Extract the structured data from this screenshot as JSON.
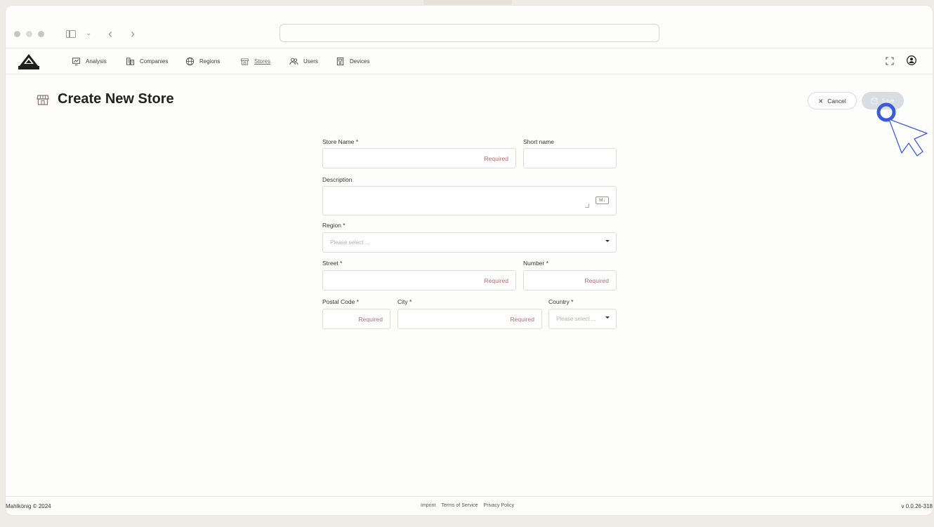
{
  "nav": {
    "items": [
      {
        "label": "Analysis",
        "icon": "chart-icon"
      },
      {
        "label": "Companies",
        "icon": "building-icon"
      },
      {
        "label": "Regions",
        "icon": "globe-icon"
      },
      {
        "label": "Stores",
        "icon": "store-icon",
        "active": true
      },
      {
        "label": "Users",
        "icon": "users-icon"
      },
      {
        "label": "Devices",
        "icon": "device-icon"
      }
    ]
  },
  "header": {
    "title": "Create New Store",
    "cancel_label": "Cancel",
    "save_label": "Save"
  },
  "form": {
    "store_name_label": "Store Name *",
    "store_name_placeholder": "Required",
    "short_name_label": "Short name",
    "description_label": "Description",
    "md_badge": "M↓",
    "region_label": "Region *",
    "region_placeholder": "Please select ...",
    "street_label": "Street *",
    "street_placeholder": "Required",
    "number_label": "Number *",
    "number_placeholder": "Required",
    "postal_label": "Postal Code *",
    "postal_placeholder": "Required",
    "city_label": "City *",
    "city_placeholder": "Required",
    "country_label": "Country *",
    "country_placeholder": "Please select ..."
  },
  "footer": {
    "copyright": "Mahlkönig © 2024",
    "imprint": "Imprint",
    "terms": "Terms of Service",
    "privacy": "Privacy Policy",
    "version": "v 0.0.26-318"
  },
  "colors": {
    "required_text": "#b06a72",
    "save_disabled_bg": "#d8dde4",
    "cursor_blue": "#3d5bd9"
  }
}
